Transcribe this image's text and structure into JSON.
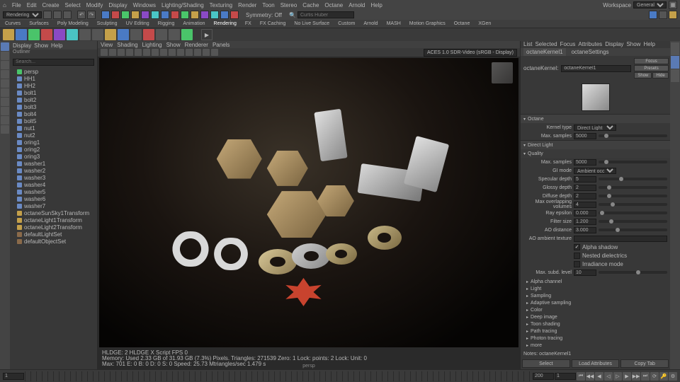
{
  "menubar": [
    "File",
    "Edit",
    "Create",
    "Select",
    "Modify",
    "Display",
    "Windows",
    "Lighting/Shading",
    "Texturing",
    "Render",
    "Toon",
    "Stereo",
    "Cache",
    "Octane",
    "Arnold",
    "Help"
  ],
  "workspace": {
    "label": "Workspace",
    "value": "General"
  },
  "mode_dropdown": "Rendering",
  "toolbar_mid": {
    "symmetry": "Symmetry: Off",
    "search_placeholder": "Curtis Huber"
  },
  "shelf_tabs": [
    "Curves",
    "Surfaces",
    "Poly Modeling",
    "Sculpting",
    "UV Editing",
    "Rigging",
    "Animation",
    "Rendering",
    "FX",
    "FX Caching",
    "No Live Surface",
    "Custom",
    "Arnold",
    "MASH",
    "Motion Graphics",
    "Octane",
    "XGen"
  ],
  "shelf_active": "Rendering",
  "outliner": {
    "title": "Outliner",
    "menus": [
      "Display",
      "Show",
      "Help"
    ],
    "search_placeholder": "Search...",
    "items": [
      {
        "name": "persp",
        "icon": "cam"
      },
      {
        "name": "HH1",
        "icon": "mesh"
      },
      {
        "name": "HH2",
        "icon": "mesh"
      },
      {
        "name": "bolt1",
        "icon": "mesh"
      },
      {
        "name": "bolt2",
        "icon": "mesh"
      },
      {
        "name": "bolt3",
        "icon": "mesh"
      },
      {
        "name": "bolt4",
        "icon": "mesh"
      },
      {
        "name": "bolt5",
        "icon": "mesh"
      },
      {
        "name": "nut1",
        "icon": "mesh"
      },
      {
        "name": "nut2",
        "icon": "mesh"
      },
      {
        "name": "oring1",
        "icon": "mesh"
      },
      {
        "name": "oring2",
        "icon": "mesh"
      },
      {
        "name": "oring3",
        "icon": "mesh"
      },
      {
        "name": "washer1",
        "icon": "mesh"
      },
      {
        "name": "washer2",
        "icon": "mesh"
      },
      {
        "name": "washer3",
        "icon": "mesh"
      },
      {
        "name": "washer4",
        "icon": "mesh"
      },
      {
        "name": "washer5",
        "icon": "mesh"
      },
      {
        "name": "washer6",
        "icon": "mesh"
      },
      {
        "name": "washer7",
        "icon": "mesh"
      },
      {
        "name": "octaneSunSky1Transform",
        "icon": "light"
      },
      {
        "name": "octaneLight1Transform",
        "icon": "light"
      },
      {
        "name": "octaneLight2Transform",
        "icon": "light"
      },
      {
        "name": "defaultLightSet",
        "icon": "set"
      },
      {
        "name": "defaultObjectSet",
        "icon": "set"
      }
    ]
  },
  "viewport": {
    "menus": [
      "View",
      "Shading",
      "Lighting",
      "Show",
      "Renderer",
      "Panels"
    ],
    "colorspace": "ACES 1.0 SDR-Video (sRGB - Display)",
    "camera_label": "persp",
    "status_line1": "HLDGE: 2 HLDGE X Script FPS 0",
    "status_line2": "Memory: Used 2.33 GB of 31.93 GB (7.3%) Pixels. Triangles: 271539 Zero: 1 Lock: points: 2 Lock: Unit: 0",
    "status_line3": "Max: 701 E: 0 B: 0 D: 0 S: 0 Speed: 25.73 Mtriangles/sec 1.479 s"
  },
  "attr_editor": {
    "top_tabs": [
      "List",
      "Selected",
      "Focus",
      "Attributes",
      "Display",
      "Show",
      "Help"
    ],
    "node_tabs": [
      "octaneKernel1",
      "octaneSettings"
    ],
    "node_field_label": "octaneKernel:",
    "node_field_value": "octaneKernel1",
    "buttons": {
      "focus": "Focus",
      "presets": "Presets",
      "show": "Show",
      "hide": "Hide"
    },
    "sections": {
      "octane": "Octane",
      "direct_light": "Direct Light",
      "quality": "Quality"
    },
    "params": {
      "kernel_type": {
        "label": "Kernel type",
        "value": "Direct Light"
      },
      "max_samples": {
        "label": "Max. samples",
        "value": "5000"
      },
      "max_samples2": {
        "label": "Max. samples",
        "value": "5000"
      },
      "gi_mode": {
        "label": "GI mode",
        "value": "Ambient occlusion"
      },
      "specular_depth": {
        "label": "Specular depth",
        "value": "5"
      },
      "glossy_depth": {
        "label": "Glossy depth",
        "value": "2"
      },
      "diffuse_depth": {
        "label": "Diffuse depth",
        "value": "2"
      },
      "max_overlap": {
        "label": "Max overlapping volumes",
        "value": "4"
      },
      "ray_epsilon": {
        "label": "Ray epsilon",
        "value": "0.000"
      },
      "filter_size": {
        "label": "Filter size",
        "value": "1.200"
      },
      "ao_distance": {
        "label": "AO distance",
        "value": "3.000"
      },
      "ao_texture": {
        "label": "AO ambient texture",
        "value": ""
      },
      "alpha_shadow": {
        "label": "Alpha shadow",
        "checked": true
      },
      "nested_diel": {
        "label": "Nested dielectrics",
        "checked": false
      },
      "irradiance": {
        "label": "Irradiance mode",
        "checked": false
      },
      "max_subd": {
        "label": "Max. subd. level",
        "value": "10"
      }
    },
    "more_groups": [
      "Alpha channel",
      "Light",
      "Sampling",
      "Adaptive sampling",
      "Color",
      "Deep image",
      "Toon shading",
      "Path tracing",
      "Photon tracing",
      "more"
    ],
    "notes_label": "Notes: octaneKernel1",
    "footer": {
      "select": "Select",
      "load": "Load Attributes",
      "copy": "Copy Tab"
    }
  },
  "timeline": {
    "start": "1",
    "end": "200",
    "current": "1"
  }
}
